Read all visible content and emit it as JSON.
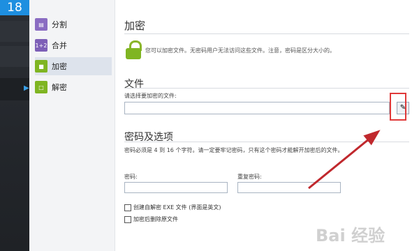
{
  "app": {
    "badge": "18"
  },
  "sidebar": {
    "items": [
      {
        "label": "分割"
      },
      {
        "label": "合并"
      },
      {
        "label": "加密"
      },
      {
        "label": "解密"
      }
    ]
  },
  "main": {
    "title": "加密",
    "description": "您可以加密文件。无密码用户无法访问这些文件。注意，密码是区分大小的。",
    "file_section": {
      "title": "文件",
      "prompt": "请选择要加密的文件:",
      "file_path": ""
    },
    "password_section": {
      "title": "密码及选项",
      "hint": "密码必须是 4 到 16 个字符。请一定要牢记密码，只有这个密码才能解开加密后的文件。",
      "password_label": "密码:",
      "confirm_label": "重复密码:",
      "password_value": "",
      "confirm_value": "",
      "options": [
        {
          "label": "创建自解密 EXE 文件 (界面是英文)",
          "checked": false
        },
        {
          "label": "加密后删除原文件",
          "checked": false
        }
      ]
    }
  },
  "watermark": "Bai 经验",
  "colors": {
    "accent": "#1e8fe0",
    "lock_green": "#7fb522",
    "highlight": "#e03a3a",
    "arrow": "#c0282d"
  }
}
